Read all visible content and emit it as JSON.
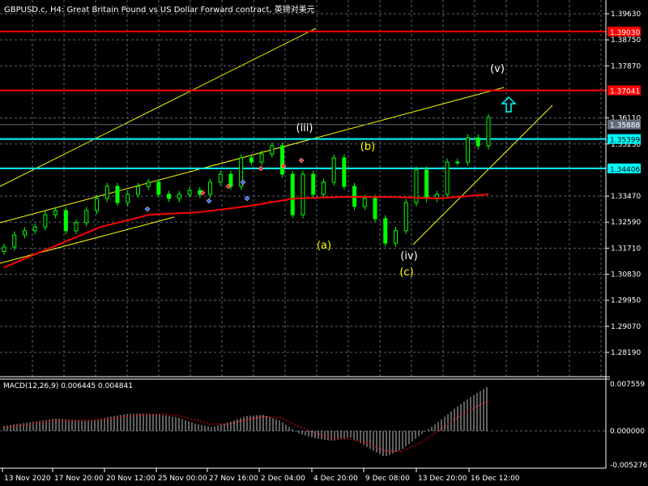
{
  "header": {
    "title": "GBPUSD.c, H4:  Great Britain Pound vs US Dollar Forward contract, 英镑对美元"
  },
  "macd": {
    "title": "MACD(12,26,9) 0.006445 0.004841"
  },
  "colors": {
    "bg": "#000000",
    "grid": "#5a6470",
    "bull": "#00ff00",
    "ma": "#ff0000",
    "trend": "#ffff00",
    "cyan": "#00ffff",
    "red_level": "#ff0000",
    "gray_level": "#5f6b78"
  },
  "chart_data": [
    {
      "type": "candlestick",
      "title": "GBPUSD.c, H4",
      "ylim": [
        1.2785,
        1.401
      ],
      "y_ticks": [
        "1.39630",
        "1.38750",
        "1.37870",
        "1.36110",
        "1.35230",
        "1.33470",
        "1.32590",
        "1.31710",
        "1.30830",
        "1.29950",
        "1.29070",
        "1.28190"
      ],
      "x_ticks": [
        "13 Nov 2020",
        "17 Nov 20:00",
        "20 Nov 12:00",
        "25 Nov 00:00",
        "27 Nov 16:00",
        "2 Dec 04:00",
        "4 Dec 20:00",
        "9 Dec 08:00",
        "13 Dec 20:00",
        "16 Dec 12:00"
      ],
      "close": [
        1.3175,
        1.3216,
        1.323,
        1.3243,
        1.3284,
        1.3298,
        1.323,
        1.3257,
        1.3298,
        1.3339,
        1.338,
        1.3325,
        1.3353,
        1.338,
        1.3394,
        1.3353,
        1.3339,
        1.3353,
        1.3366,
        1.3353,
        1.3394,
        1.3421,
        1.338,
        1.3476,
        1.3462,
        1.3489,
        1.3517,
        1.3421,
        1.3284,
        1.3421,
        1.3353,
        1.3394,
        1.3476,
        1.338,
        1.3312,
        1.3339,
        1.3271,
        1.3188,
        1.323,
        1.3325,
        1.3435,
        1.3339,
        1.3353,
        1.3462,
        1.3462,
        1.3544,
        1.3517,
        1.3613
      ],
      "moving_average": [
        1.3106,
        1.3175,
        1.3243,
        1.3284,
        1.3292,
        1.3312,
        1.3339,
        1.3344,
        1.3344,
        1.3339,
        1.3353
      ],
      "levels": [
        {
          "price": 1.3903,
          "label": "1.39030",
          "color": "#ff0000"
        },
        {
          "price": 1.37041,
          "label": "1.37041",
          "color": "#ff0000"
        },
        {
          "price": 1.35888,
          "label": "1.35888",
          "color": "#5f6b78"
        },
        {
          "price": 1.35399,
          "label": "1.35399",
          "color": "#00ffff"
        },
        {
          "price": 1.34406,
          "label": "1.34406",
          "color": "#00ffff"
        }
      ],
      "wave_labels": [
        {
          "text": "(iii)",
          "color": "#ffffff"
        },
        {
          "text": "(b)",
          "color": "#ffff00"
        },
        {
          "text": "(a)",
          "color": "#ffff00"
        },
        {
          "text": "(iv)",
          "color": "#ffffff"
        },
        {
          "text": "(c)",
          "color": "#ffff00"
        },
        {
          "text": "(v)",
          "color": "#ffffff"
        }
      ]
    },
    {
      "type": "bar",
      "title": "MACD(12,26,9)",
      "ylim": [
        -0.005276,
        0.007559
      ],
      "y_ticks": [
        "0.007559",
        "0.000000",
        "-0.005276"
      ],
      "histogram": [
        0.0008,
        0.0012,
        0.0016,
        0.002,
        0.0018,
        0.0016,
        0.0022,
        0.0027,
        0.0028,
        0.0026,
        0.0022,
        0.0012,
        0.0006,
        0.0014,
        0.0024,
        0.0026,
        0.0016,
        -0.0004,
        -0.0012,
        -0.0016,
        -0.001,
        -0.0026,
        -0.0042,
        -0.003,
        -0.0008,
        0.0012,
        0.0035,
        0.0055,
        0.0072
      ],
      "signal": [
        0.0005,
        0.0009,
        0.0013,
        0.0016,
        0.0017,
        0.0017,
        0.0019,
        0.0023,
        0.0026,
        0.0027,
        0.0025,
        0.0018,
        0.0011,
        0.0011,
        0.0018,
        0.0023,
        0.0021,
        0.0008,
        -0.0004,
        -0.0012,
        -0.0013,
        -0.002,
        -0.0032,
        -0.0033,
        -0.002,
        -0.0002,
        0.0018,
        0.0035,
        0.0048
      ]
    }
  ]
}
